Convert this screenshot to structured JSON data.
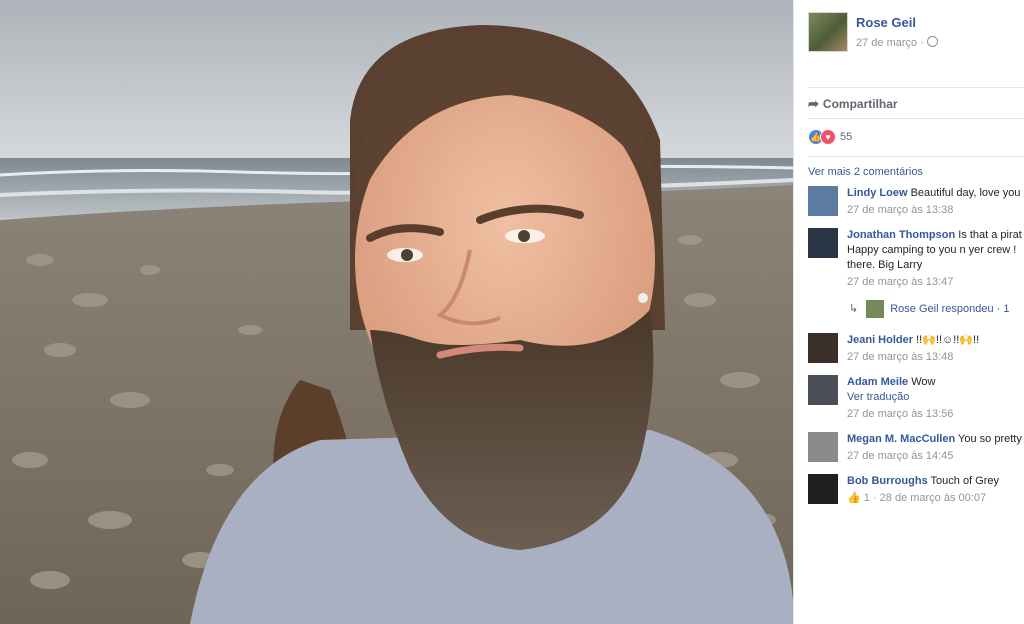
{
  "post": {
    "author": "Rose Geil",
    "date": "27 de março ·",
    "share_label": "Compartilhar",
    "reaction_count": "55",
    "view_more_comments": "Ver mais 2 comentários"
  },
  "comments": [
    {
      "name": "Lindy Loew",
      "text": "Beautiful day, love you",
      "time": "27 de março às 13:38"
    },
    {
      "name": "Jonathan Thompson",
      "text": "Is that a pirat",
      "text2": "Happy camping to you n yer crew !",
      "text3": "there. Big Larry",
      "time": "27 de março às 13:47"
    },
    {
      "name": "Jeani Holder",
      "text": "!!🙌!!☺!!🙌!!",
      "time": "27 de março às 13:48"
    },
    {
      "name": "Adam Meile",
      "text": "Wow",
      "link": "Ver tradução",
      "time": "27 de março às 13:56"
    },
    {
      "name": "Megan M. MacCullen",
      "text": "You so pretty",
      "time": "27 de março às 14:45"
    },
    {
      "name": "Bob Burroughs",
      "text": "Touch of Grey",
      "time": "1 · 28 de março às 00:07"
    }
  ],
  "reply": {
    "text": "Rose Geil respondeu · 1"
  },
  "colors": {
    "link": "#365899",
    "meta": "#90949c",
    "like": "#4d7fe5",
    "love": "#f25268"
  }
}
